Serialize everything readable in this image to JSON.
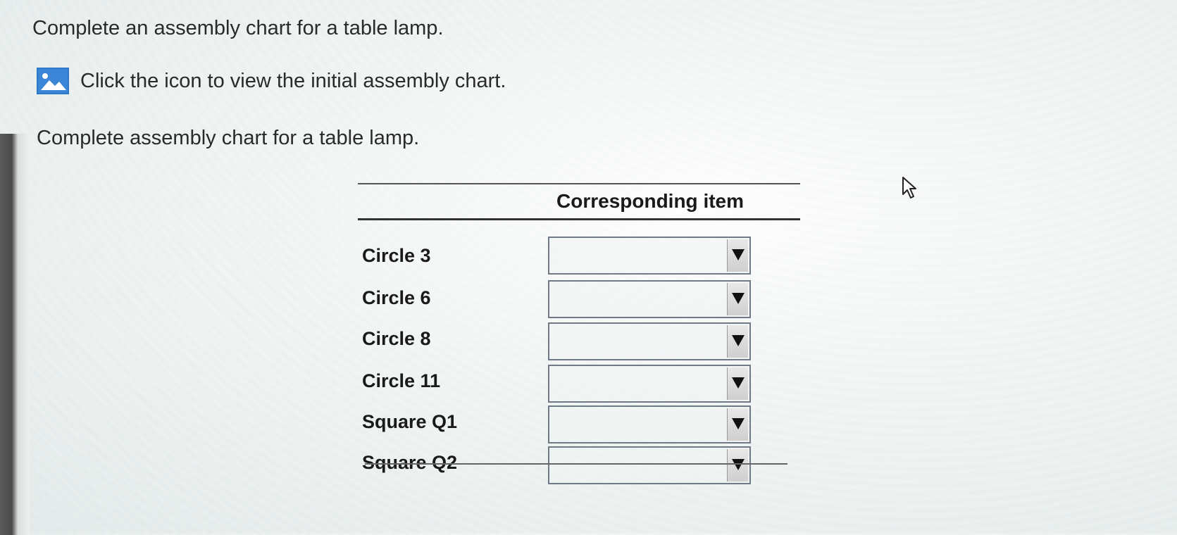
{
  "instruction": "Complete an assembly chart for a table lamp.",
  "icon_link": {
    "icon": "image-icon",
    "text": "Click the icon to view the initial assembly chart."
  },
  "chart_title": "Complete assembly chart for a table lamp.",
  "table": {
    "header": "Corresponding item",
    "rows": [
      {
        "label": "Circle 3",
        "value": ""
      },
      {
        "label": "Circle 6",
        "value": ""
      },
      {
        "label": "Circle 8",
        "value": ""
      },
      {
        "label": "Circle 11",
        "value": ""
      },
      {
        "label": "Square Q1",
        "value": ""
      },
      {
        "label": "Square Q2",
        "value": ""
      }
    ]
  },
  "colors": {
    "icon_blue": "#3b86d6",
    "select_border": "#6f7a86"
  }
}
